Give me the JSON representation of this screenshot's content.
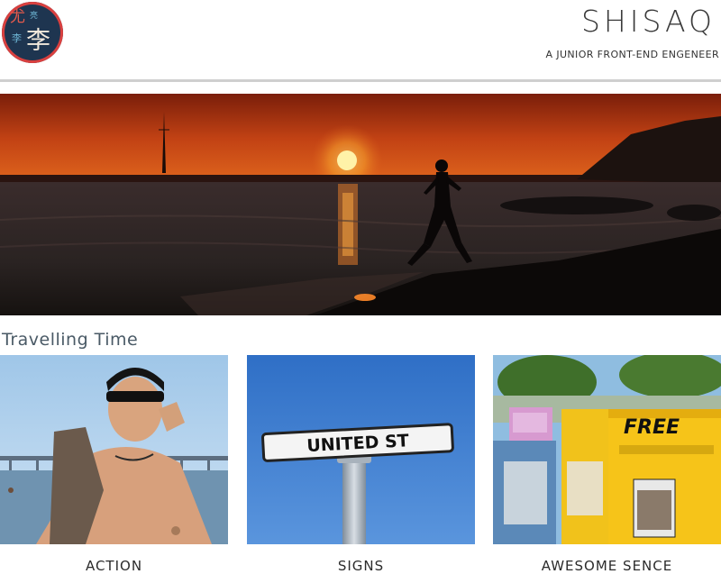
{
  "header": {
    "logo_chars": [
      "尤",
      "亮",
      "李",
      "李"
    ],
    "title": "SHISAQ",
    "tagline": "A JUNIOR FRONT-END ENGENEER"
  },
  "section": {
    "heading": "Travelling Time"
  },
  "gallery": [
    {
      "caption": "ACTION"
    },
    {
      "caption": "SIGNS",
      "sign_text": "UNITED ST"
    },
    {
      "caption": "AWESOME SENCE",
      "box_text": "FREE"
    }
  ],
  "colors": {
    "logo_bg": "#1e3550",
    "logo_ring": "#d9403f",
    "rule": "#cfcfcf",
    "heading": "#4a5a66"
  }
}
